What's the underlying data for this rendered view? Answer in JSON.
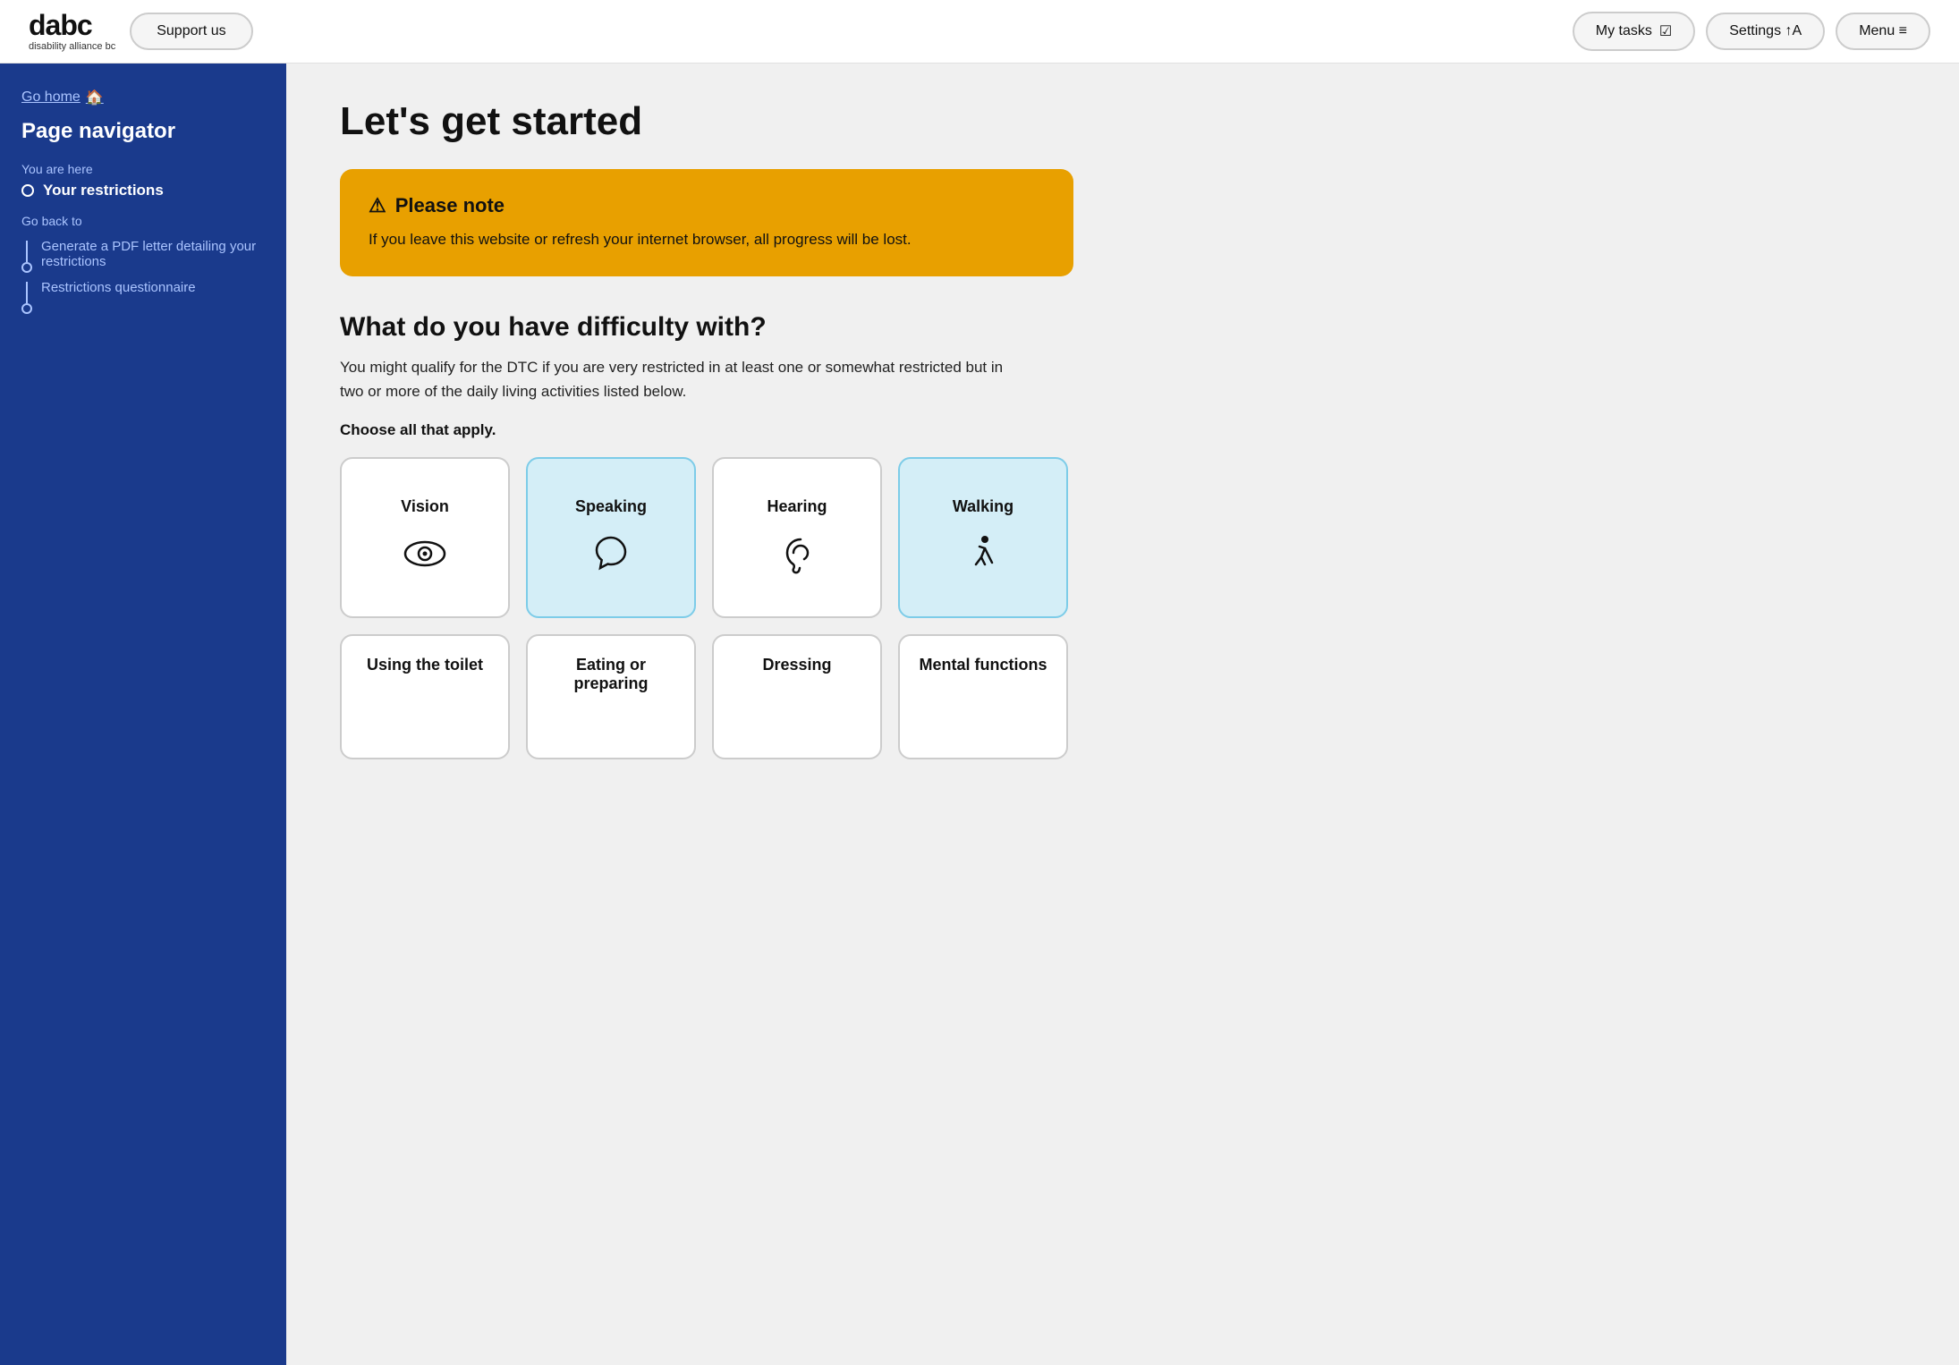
{
  "header": {
    "logo_text": "dabc",
    "logo_sub": "disability alliance bc",
    "support_label": "Support us",
    "my_tasks_label": "My tasks",
    "my_tasks_icon": "☑",
    "settings_label": "Settings ↑A",
    "menu_label": "Menu ≡"
  },
  "sidebar": {
    "go_home_label": "Go home",
    "title": "Page navigator",
    "you_are_here_label": "You are here",
    "current_item": "Your restrictions",
    "go_back_label": "Go back to",
    "back_items": [
      "Generate a PDF letter detailing your restrictions",
      "Restrictions questionnaire"
    ]
  },
  "main": {
    "page_title": "Let's get started",
    "notice_title": "Please note",
    "notice_icon": "⚠",
    "notice_text": "If you leave this website or refresh your internet browser, all progress will be lost.",
    "question_title": "What do you have difficulty with?",
    "question_desc": "You might qualify for the DTC if you are very restricted in at least one or somewhat restricted but in two or more of the daily living activities listed below.",
    "choose_label": "Choose all that apply.",
    "activities": [
      {
        "id": "vision",
        "label": "Vision",
        "selected": false,
        "icon": "vision"
      },
      {
        "id": "speaking",
        "label": "Speaking",
        "selected": true,
        "icon": "speaking"
      },
      {
        "id": "hearing",
        "label": "Hearing",
        "selected": false,
        "icon": "hearing"
      },
      {
        "id": "walking",
        "label": "Walking",
        "selected": true,
        "icon": "walking"
      }
    ],
    "activities_row2": [
      {
        "id": "toilet",
        "label": "Using the toilet",
        "selected": false,
        "icon": "toilet"
      },
      {
        "id": "eating",
        "label": "Eating or preparing",
        "selected": false,
        "icon": "eating"
      },
      {
        "id": "dressing",
        "label": "Dressing",
        "selected": false,
        "icon": "dressing"
      },
      {
        "id": "mental",
        "label": "Mental functions",
        "selected": false,
        "icon": "mental"
      }
    ]
  }
}
